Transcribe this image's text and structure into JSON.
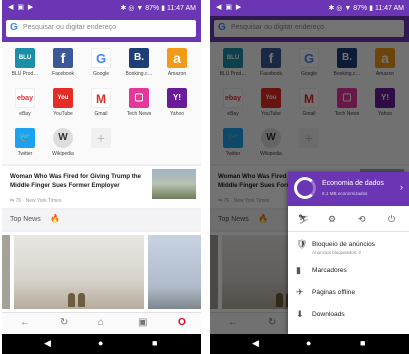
{
  "status": {
    "left_icons": "◀ ▣ ▶",
    "right_text": "✱ ◎ ▼ 87% ▮ 11:47 AM",
    "right_text_2": "✱ ◎ ▼ 87% ▮ 11:47 AM"
  },
  "search": {
    "placeholder": "Pesquisar ou digitar endereço",
    "g": "G"
  },
  "speed_dial": [
    {
      "label": "BLU Prod…",
      "icon": "BLU",
      "color": "#1c8fa8"
    },
    {
      "label": "Facebook",
      "icon": "f",
      "color": "#3b5998"
    },
    {
      "label": "Google",
      "icon": "G",
      "color": "#ffffff"
    },
    {
      "label": "Booking.c…",
      "icon": "B.",
      "color": "#1e3e78"
    },
    {
      "label": "Amazon",
      "icon": "a",
      "color": "#f29a1a"
    },
    {
      "label": "eBay",
      "icon": "ebay",
      "color": "#ffffff"
    },
    {
      "label": "YouTube",
      "icon": "You",
      "color": "#e52d27"
    },
    {
      "label": "Gmail",
      "icon": "M",
      "color": "#ffffff"
    },
    {
      "label": "Tech News",
      "icon": "▢",
      "color": "#e5369b"
    },
    {
      "label": "Yahoo",
      "icon": "Y!",
      "color": "#6a1b9a"
    },
    {
      "label": "Twitter",
      "icon": "🐦",
      "color": "#1da1f2"
    },
    {
      "label": "Wikipedia",
      "icon": "W",
      "color": "#dddddd"
    },
    {
      "label": "",
      "icon": "+",
      "color": "#f0f0f0"
    }
  ],
  "news": {
    "title": "Woman Who Was Fired for Giving Trump the Middle Finger Sues Former Employer",
    "meta": "⇆ 76 · New York Times"
  },
  "top_news": {
    "label": "Top News",
    "fire": "🔥"
  },
  "bottom_nav": {
    "back": "←",
    "reload": "↻",
    "home": "⌂",
    "tabs": "▣",
    "opera": "O"
  },
  "system_nav": {
    "back": "◀",
    "home": "●",
    "recent": "■"
  },
  "menu": {
    "header_title": "Economia de dados",
    "header_sub": "6,1 MB economizados",
    "header_chev": "›",
    "icon_row": [
      "⛷",
      "⚙",
      "⟲",
      "⏻"
    ],
    "items": [
      {
        "icon": "🛡",
        "label": "Bloqueio de anúncios",
        "sub": "Anúncios bloqueados: 2"
      },
      {
        "icon": "▮",
        "label": "Marcadores",
        "sub": ""
      },
      {
        "icon": "✈",
        "label": "Páginas offline",
        "sub": ""
      },
      {
        "icon": "⬇",
        "label": "Downloads",
        "sub": ""
      }
    ]
  }
}
